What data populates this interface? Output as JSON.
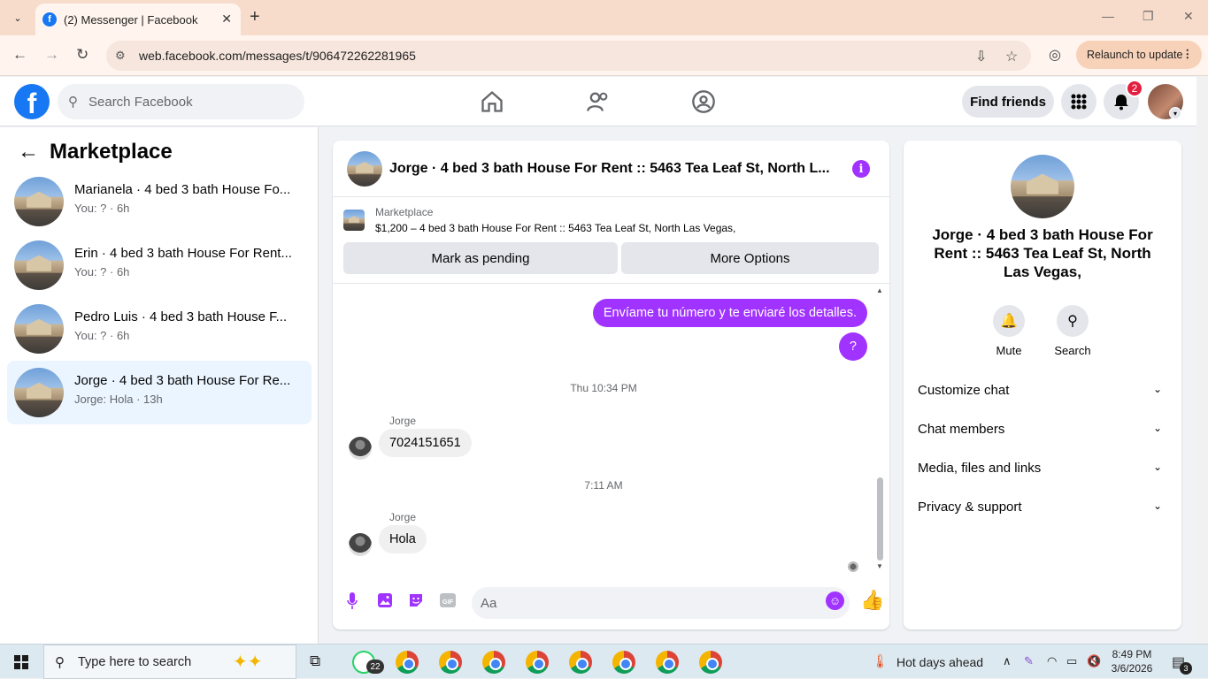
{
  "browser": {
    "tab_title": "(2) Messenger | Facebook",
    "url": "web.facebook.com/messages/t/906472262281965",
    "relaunch_label": "Relaunch to update"
  },
  "fb_header": {
    "search_placeholder": "Search Facebook",
    "find_friends_label": "Find friends",
    "notification_count": "2"
  },
  "left_panel": {
    "title": "Marketplace",
    "conversations": [
      {
        "name": "Marianela · 4 bed 3 bath House Fo...",
        "sub": "You: ? · 6h",
        "active": false
      },
      {
        "name": "Erin · 4 bed 3 bath House For Rent...",
        "sub": "You: ? · 6h",
        "active": false
      },
      {
        "name": "Pedro Luis · 4 bed 3 bath House F...",
        "sub": "You: ? · 6h",
        "active": false
      },
      {
        "name": "Jorge · 4 bed 3 bath House For Re...",
        "sub": "Jorge: Hola · 13h",
        "active": true
      }
    ]
  },
  "chat": {
    "title": "Jorge · 4 bed 3 bath House For Rent :: 5463 Tea Leaf St, North L...",
    "listing_category": "Marketplace",
    "listing_desc": "$1,200 – 4 bed 3 bath House For Rent :: 5463 Tea Leaf St, North Las Vegas,",
    "mark_pending_label": "Mark as pending",
    "more_options_label": "More Options",
    "messages": {
      "out1": "Envíame tu número y te enviaré los detalles.",
      "out2": "?",
      "ts1": "Thu 10:34 PM",
      "sender1": "Jorge",
      "in1": "7024151651",
      "ts2": "7:11 AM",
      "sender2": "Jorge",
      "in2": "Hola"
    },
    "input_placeholder": "Aa"
  },
  "right_panel": {
    "title": "Jorge · 4 bed 3 bath House For Rent :: 5463 Tea Leaf St, North Las Vegas,",
    "mute_label": "Mute",
    "search_label": "Search",
    "sections": [
      "Customize chat",
      "Chat members",
      "Media, files and links",
      "Privacy & support"
    ]
  },
  "taskbar": {
    "search_placeholder": "Type here to search",
    "whatsapp_badge": "22",
    "weather": "Hot days ahead",
    "time": "8:49 PM",
    "date": "3/6/2026",
    "notif_count": "3"
  },
  "colors": {
    "accent": "#a033ff",
    "fb_blue": "#1877f2",
    "active_conv": "#ebf5ff"
  }
}
